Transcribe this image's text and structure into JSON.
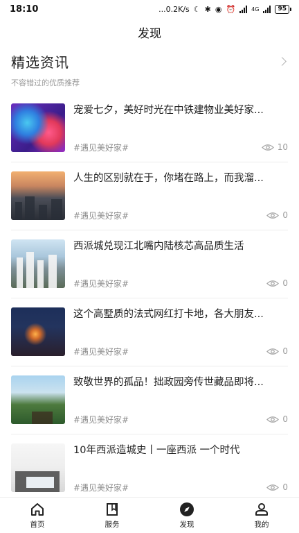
{
  "status_bar": {
    "time": "18:10",
    "indicators": "...0.2K/s",
    "battery": "95",
    "network": "4G"
  },
  "header": {
    "title": "发现"
  },
  "section": {
    "title": "精选资讯",
    "subtitle": "不容错过的优质推荐"
  },
  "articles": [
    {
      "title": "宠爱七夕，美好时光在中铁建物业美好家...",
      "tag": "#遇见美好家#",
      "views": "10"
    },
    {
      "title": "人生的区别就在于，你堵在路上，而我溜...",
      "tag": "#遇见美好家#",
      "views": "0"
    },
    {
      "title": "西派城兑现江北嘴内陆核芯高品质生活",
      "tag": "#遇见美好家#",
      "views": "0"
    },
    {
      "title": "这个高墅质的法式网红打卡地，各大朋友...",
      "tag": "#遇见美好家#",
      "views": "0"
    },
    {
      "title": "致敬世界的孤品！拙政园旁传世藏品即将...",
      "tag": "#遇见美好家#",
      "views": "0"
    },
    {
      "title": "10年西派造城史丨一座西派 一个时代",
      "tag": "#遇见美好家#",
      "views": "0"
    }
  ],
  "bottom_nav": [
    {
      "label": "首页",
      "icon": "home-icon"
    },
    {
      "label": "服务",
      "icon": "book-icon"
    },
    {
      "label": "发现",
      "icon": "compass-icon"
    },
    {
      "label": "我的",
      "icon": "user-icon"
    }
  ]
}
